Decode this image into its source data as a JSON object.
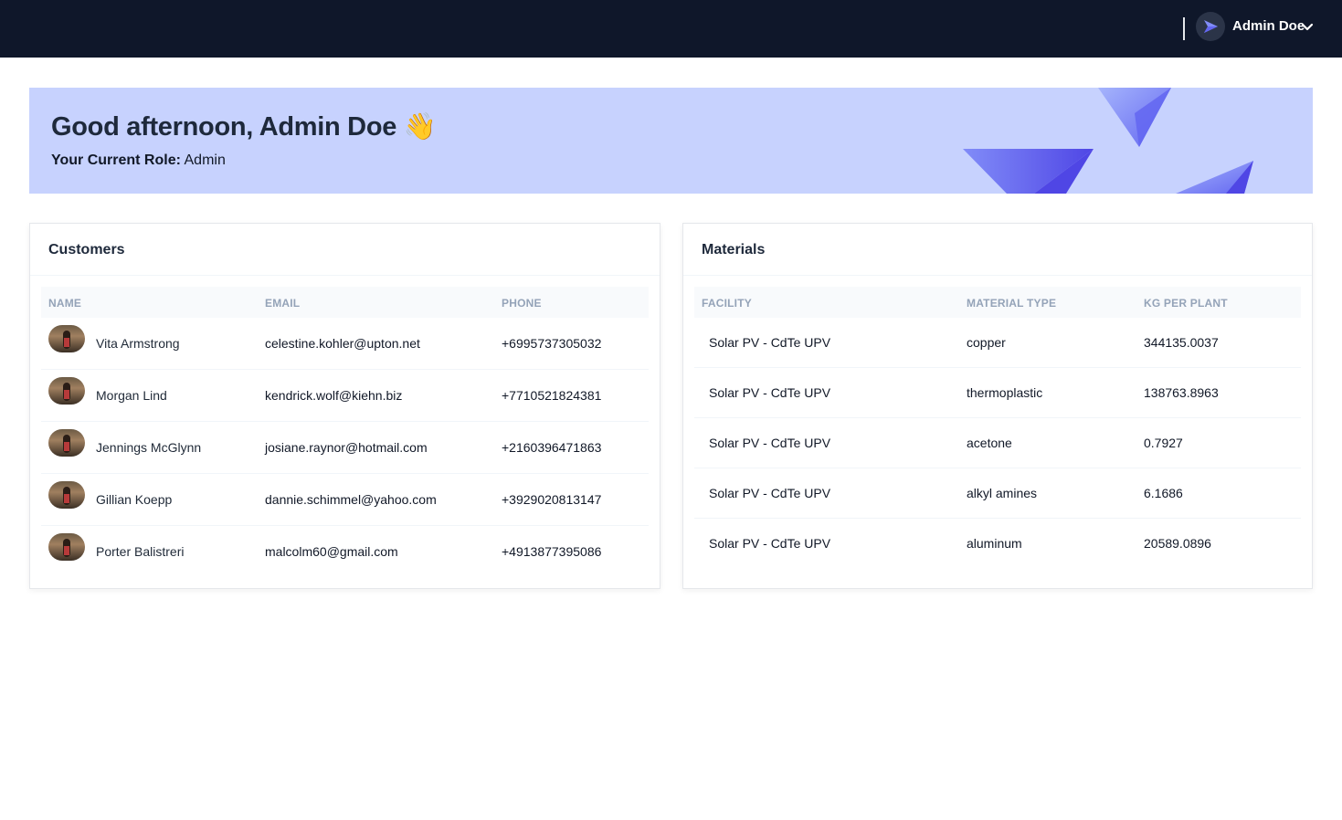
{
  "header": {
    "user_name": "Admin Doe",
    "avatar_icon": "paper-plane-icon",
    "dropdown_icon": "chevron-down-icon"
  },
  "banner": {
    "greeting": "Good afternoon, Admin Doe 👋",
    "role_label": "Your Current Role:",
    "role_value": "Admin"
  },
  "customers": {
    "title": "Customers",
    "columns": [
      "NAME",
      "EMAIL",
      "PHONE"
    ],
    "rows": [
      {
        "name": "Vita Armstrong",
        "email": "celestine.kohler@upton.net",
        "phone": "+6995737305032"
      },
      {
        "name": "Morgan Lind",
        "email": "kendrick.wolf@kiehn.biz",
        "phone": "+7710521824381"
      },
      {
        "name": "Jennings McGlynn",
        "email": "josiane.raynor@hotmail.com",
        "phone": "+2160396471863"
      },
      {
        "name": "Gillian Koepp",
        "email": "dannie.schimmel@yahoo.com",
        "phone": "+3929020813147"
      },
      {
        "name": "Porter Balistreri",
        "email": "malcolm60@gmail.com",
        "phone": "+4913877395086"
      }
    ]
  },
  "materials": {
    "title": "Materials",
    "columns": [
      "FACILITY",
      "MATERIAL TYPE",
      "KG PER PLANT"
    ],
    "rows": [
      {
        "facility": "Solar PV - CdTe UPV",
        "material_type": "copper",
        "kg_per_plant": "344135.0037"
      },
      {
        "facility": "Solar PV - CdTe UPV",
        "material_type": "thermoplastic",
        "kg_per_plant": "138763.8963"
      },
      {
        "facility": "Solar PV - CdTe UPV",
        "material_type": "acetone",
        "kg_per_plant": "0.7927"
      },
      {
        "facility": "Solar PV - CdTe UPV",
        "material_type": "alkyl amines",
        "kg_per_plant": "6.1686"
      },
      {
        "facility": "Solar PV - CdTe UPV",
        "material_type": "aluminum",
        "kg_per_plant": "20589.0896"
      }
    ]
  },
  "colors": {
    "topbar": "#0f172a",
    "banner": "#c7d2fe",
    "accent": "#6366f1"
  }
}
